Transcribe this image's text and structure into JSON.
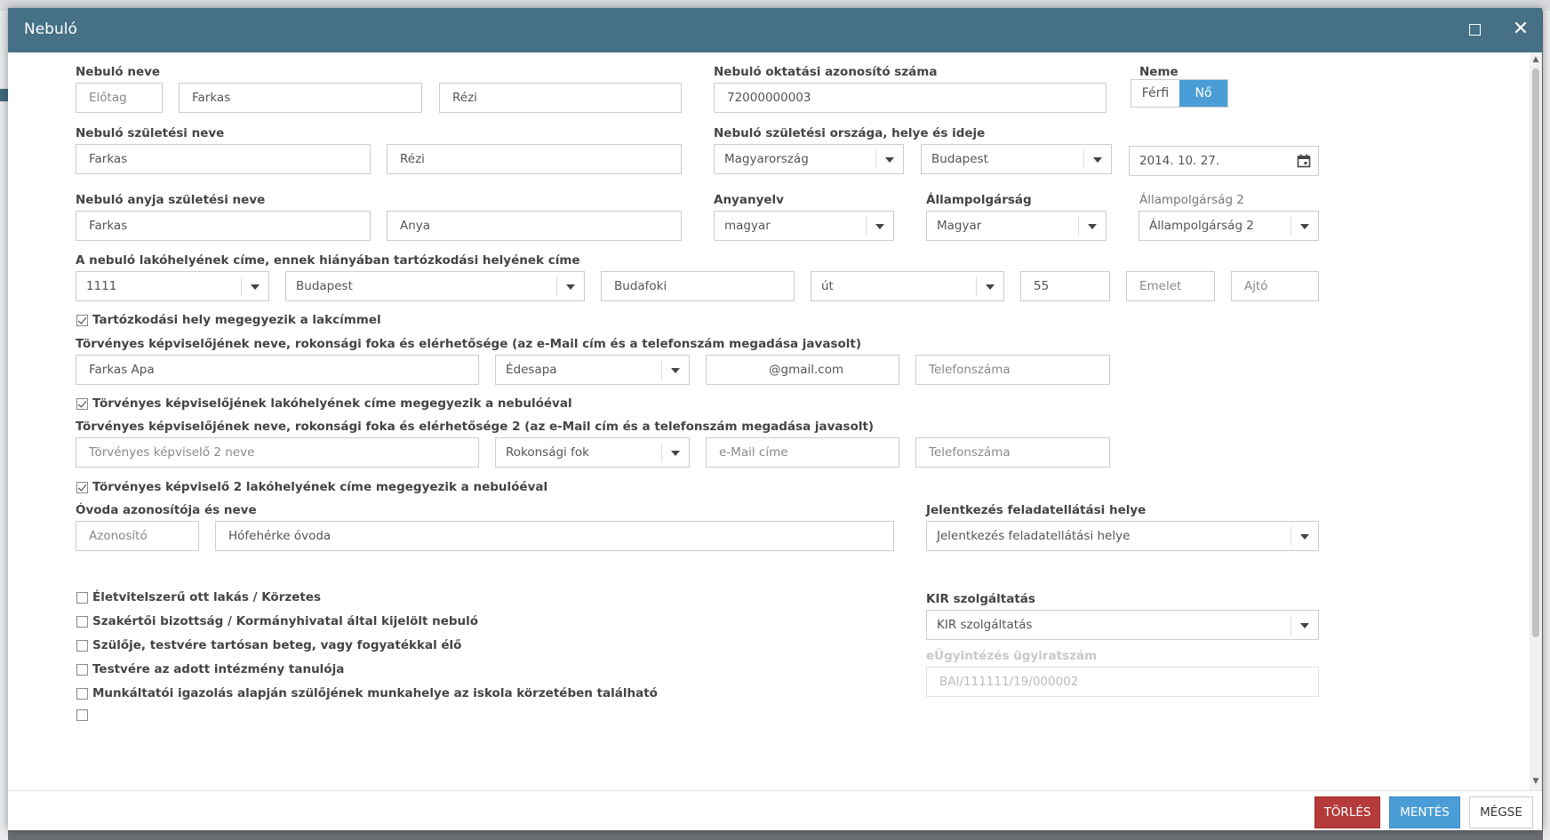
{
  "dialog": {
    "title": "Nebuló",
    "maximize_icon": "maximize-icon",
    "close_icon": "close-icon"
  },
  "name": {
    "label": "Nebuló neve",
    "prefix_placeholder": "Előtag",
    "last": "Farkas",
    "first": "Rézi"
  },
  "edu_id": {
    "label": "Nebuló oktatási azonosító száma",
    "value": "72000000003"
  },
  "gender": {
    "label": "Neme",
    "options": [
      "Férfi",
      "Nő"
    ],
    "selected": "Nő"
  },
  "birth_name": {
    "label": "Nebuló születési neve",
    "last": "Farkas",
    "first": "Rézi"
  },
  "birth_place": {
    "label": "Nebuló születési országa, helye és ideje",
    "country": "Magyarország",
    "city": "Budapest",
    "date": "2014. 10. 27.",
    "calendar_icon": "calendar-icon"
  },
  "mother_name": {
    "label": "Nebuló anyja születési neve",
    "last": "Farkas",
    "first": "Anya"
  },
  "mother_tongue": {
    "label": "Anyanyelv",
    "value": "magyar"
  },
  "citizenship": {
    "label": "Állampolgárság",
    "value": "Magyar"
  },
  "citizenship2": {
    "label": "Állampolgárság 2",
    "placeholder": "Állampolgárság 2"
  },
  "address": {
    "label": "A nebuló lakóhelyének címe, ennek hiányában tartózkodási helyének címe",
    "zip": "1111",
    "city": "Budapest",
    "street": "Budafoki",
    "street_type": "út",
    "number": "55",
    "floor_placeholder": "Emelet",
    "door_placeholder": "Ajtó"
  },
  "residence_same": {
    "label": "Tartózkodási hely megegyezik a lakcímmel",
    "checked": true
  },
  "guardian1": {
    "label": "Törvényes képviselőjének neve, rokonsági foka és elérhetősége (az e-Mail cím és a telefonszám megadása javasolt)",
    "name": "Farkas Apa",
    "relation": "Édesapa",
    "email": "@gmail.com",
    "phone_placeholder": "Telefonszáma"
  },
  "guardian1_same": {
    "label": "Törvényes képviselőjének lakóhelyének címe megegyezik a nebulóéval",
    "checked": true
  },
  "guardian2": {
    "label": "Törvényes képviselőjének neve, rokonsági foka és elérhetősége 2 (az e-Mail cím és a telefonszám megadása javasolt)",
    "name_placeholder": "Törvényes képviselő 2 neve",
    "relation_placeholder": "Rokonsági fok",
    "email_placeholder": "e-Mail címe",
    "phone_placeholder": "Telefonszáma"
  },
  "guardian2_same": {
    "label": "Törvényes képviselő 2 lakóhelyének címe megegyezik a nebulóéval",
    "checked": true
  },
  "kindergarten": {
    "label": "Óvoda azonosítója és neve",
    "id_placeholder": "Azonosító",
    "name": "Hófehérke óvoda"
  },
  "registration_place": {
    "label": "Jelentkezés feladatellátási helye",
    "placeholder": "Jelentkezés feladatellátási helye"
  },
  "checkboxes": [
    {
      "label": "Életvitelszerű ott lakás / Körzetes",
      "checked": false
    },
    {
      "label": "Szakértői bizottság / Kormányhivatal által kijelölt nebuló",
      "checked": false
    },
    {
      "label": "Szülője, testvére tartósan beteg, vagy fogyatékkal élő",
      "checked": false
    },
    {
      "label": "Testvére az adott intézmény tanulója",
      "checked": false
    },
    {
      "label": "Munkáltatói igazolás alapján szülőjének munkahelye az iskola körzetében található",
      "checked": false
    }
  ],
  "kir": {
    "label": "KIR szolgáltatás",
    "placeholder": "KIR szolgáltatás"
  },
  "eugy": {
    "label": "eÜgyintézés ügyiratszám",
    "placeholder": "BAI/111111/19/000002"
  },
  "footer": {
    "delete": "TÖRLÉS",
    "save": "MENTÉS",
    "cancel": "MÉGSE"
  },
  "colors": {
    "header": "#457085",
    "primary": "#4a9dd6",
    "danger": "#b53a3a"
  }
}
